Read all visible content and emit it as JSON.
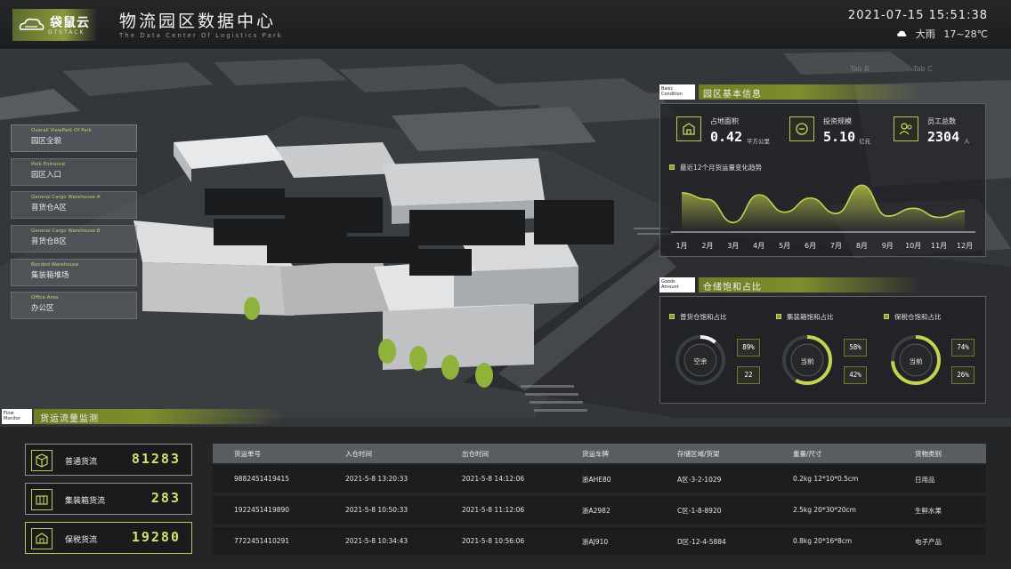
{
  "header": {
    "logo_name": "袋鼠云",
    "logo_sub": "DTSTACK",
    "title": "物流园区数据中心",
    "subtitle": "The Data Center Of Logistics Park",
    "datetime": "2021-07-15 15:51:38",
    "weather_text": "大雨",
    "temperature": "17~28℃"
  },
  "nav": [
    {
      "en": "Overall ViewPark Of Park",
      "cn": "园区全貌"
    },
    {
      "en": "Park Entrance",
      "cn": "园区入口"
    },
    {
      "en": "General Cargo Warehouse A",
      "cn": "普货仓A区"
    },
    {
      "en": "General Cargo Warehouse B",
      "cn": "普货仓B区"
    },
    {
      "en": "Bonded Warehouse",
      "cn": "集装箱堆场"
    },
    {
      "en": "Office Area",
      "cn": "办公区"
    }
  ],
  "scene_labels": {
    "tab_b": "Tab B",
    "tab_c": "Tab C"
  },
  "basic": {
    "tag": "Basic Condition",
    "title": "园区基本信息",
    "stats": [
      {
        "icon": "building-icon",
        "label": "占地面积",
        "value": "0.42",
        "unit": "平方公里"
      },
      {
        "icon": "coin-icon",
        "label": "投资规模",
        "value": "5.10",
        "unit": "亿元"
      },
      {
        "icon": "people-icon",
        "label": "员工总数",
        "value": "2304",
        "unit": "人"
      }
    ],
    "trend_title": "最近12个月货运量变化趋势"
  },
  "chart_data": {
    "type": "area",
    "title": "最近12个月货运量变化趋势",
    "categories": [
      "1月",
      "2月",
      "3月",
      "4月",
      "5月",
      "6月",
      "7月",
      "8月",
      "9月",
      "10月",
      "11月",
      "12月"
    ],
    "values": [
      58,
      48,
      12,
      55,
      28,
      50,
      26,
      70,
      22,
      34,
      20,
      30
    ],
    "ylim": [
      0,
      80
    ],
    "grid": false,
    "color": "#c6d34e"
  },
  "warehouse": {
    "tag": "Goods Amount",
    "title": "仓储饱和占比",
    "gauges": [
      {
        "label": "普货仓饱和占比",
        "center": "空余",
        "fraction": 0.11,
        "box1": "89%",
        "box2": "22"
      },
      {
        "label": "集装箱饱和占比",
        "center": "当前",
        "fraction": 0.58,
        "box1": "58%",
        "box2": "42%"
      },
      {
        "label": "保税仓饱和占比",
        "center": "当前",
        "fraction": 0.74,
        "box1": "74%",
        "box2": "26%"
      }
    ]
  },
  "flow": {
    "tag": "Flow Monitor",
    "title": "货运流量监测",
    "cards": [
      {
        "icon": "cube-icon",
        "label": "普通货流",
        "value": "81283"
      },
      {
        "icon": "container-icon",
        "label": "集装箱货流",
        "value": "283"
      },
      {
        "icon": "bonded-icon",
        "label": "保税货流",
        "value": "19280"
      }
    ]
  },
  "table": {
    "headers": [
      "货运单号",
      "入仓时间",
      "出仓时间",
      "货运车牌",
      "存储区域/货架",
      "重量/尺寸",
      "货物类别"
    ],
    "rows": [
      [
        "9882451419415",
        "2021-5-8 13:20:33",
        "2021-5-8 14:12:06",
        "浙AHE80",
        "A区-3-2-1029",
        "0.2kg 12*10*0.5cm",
        "日用品"
      ],
      [
        "1922451419890",
        "2021-5-8 10:50:33",
        "2021-5-8 11:12:06",
        "浙A2982",
        "C区-1-8-8920",
        "2.5kg 20*30*20cm",
        "生鲜水果"
      ],
      [
        "7722451410291",
        "2021-5-8 10:34:43",
        "2021-5-8 10:56:06",
        "浙AJ910",
        "D区-12-4-5884",
        "0.8kg 20*16*8cm",
        "电子产品"
      ]
    ]
  }
}
